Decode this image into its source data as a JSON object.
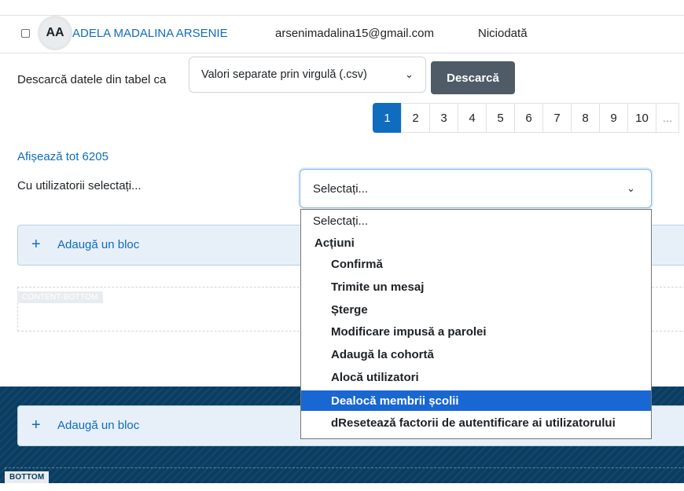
{
  "user_row": {
    "initials": "AA",
    "name": "ADELA MADALINA ARSENIE",
    "email": "arsenimadalina15@gmail.com",
    "last_access": "Niciodată"
  },
  "download": {
    "label": "Descarcă datele din tabel ca",
    "format_selected": "Valori separate prin virgulă (.csv)",
    "button": "Descarcă"
  },
  "pagination": {
    "pages": [
      "1",
      "2",
      "3",
      "4",
      "5",
      "6",
      "7",
      "8",
      "9",
      "10",
      "..."
    ],
    "current": "1"
  },
  "show_all": "Afișează tot 6205",
  "with_selected": {
    "label": "Cu utilizatorii selectați...",
    "selected": "Selectați..."
  },
  "dropdown": {
    "placeholder": "Selectați...",
    "group_label": "Acțiuni",
    "options": [
      "Confirmă",
      "Trimite un mesaj",
      "Șterge",
      "Modificare impusă a parolei",
      "Adaugă la cohortă",
      "Alocă utilizatori",
      "Dealocă membrii școlii",
      "dReseteazǎ factorii de autentificare ai utilizatorului"
    ],
    "highlighted": "Dealocă membrii școlii"
  },
  "add_block": {
    "plus": "+",
    "label": "Adaugă un bloc"
  },
  "regions": {
    "content_bottom": "CONTENT-BOTTOM",
    "bottom": "BOTTOM"
  },
  "colors": {
    "link": "#0f6cbf",
    "footer_bg": "#0a3d62",
    "highlight": "#1967d2",
    "button": "#4f5b67"
  },
  "icons": {
    "chevron": "chevron-down-icon",
    "plus": "plus-icon"
  }
}
